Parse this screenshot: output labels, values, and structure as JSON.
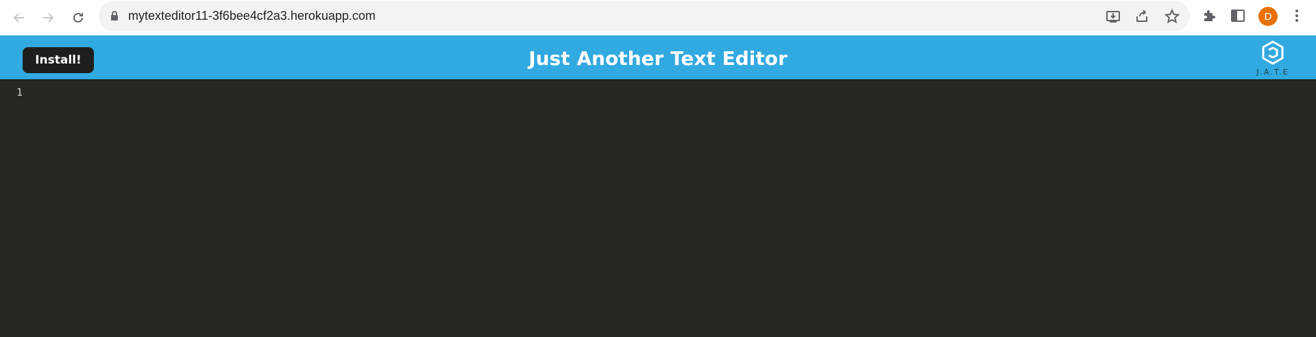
{
  "browser": {
    "url": "mytexteditor11-3f6bee4cf2a3.herokuapp.com",
    "profile_initial": "D",
    "profile_color": "#e8710a"
  },
  "app": {
    "install_label": "Install!",
    "title": "Just Another Text Editor",
    "logo_text": "J.A.T.E",
    "header_color": "#31a9e1",
    "editor_bg": "#272822"
  },
  "editor": {
    "line_numbers": [
      "1"
    ],
    "lines": [
      ""
    ]
  }
}
